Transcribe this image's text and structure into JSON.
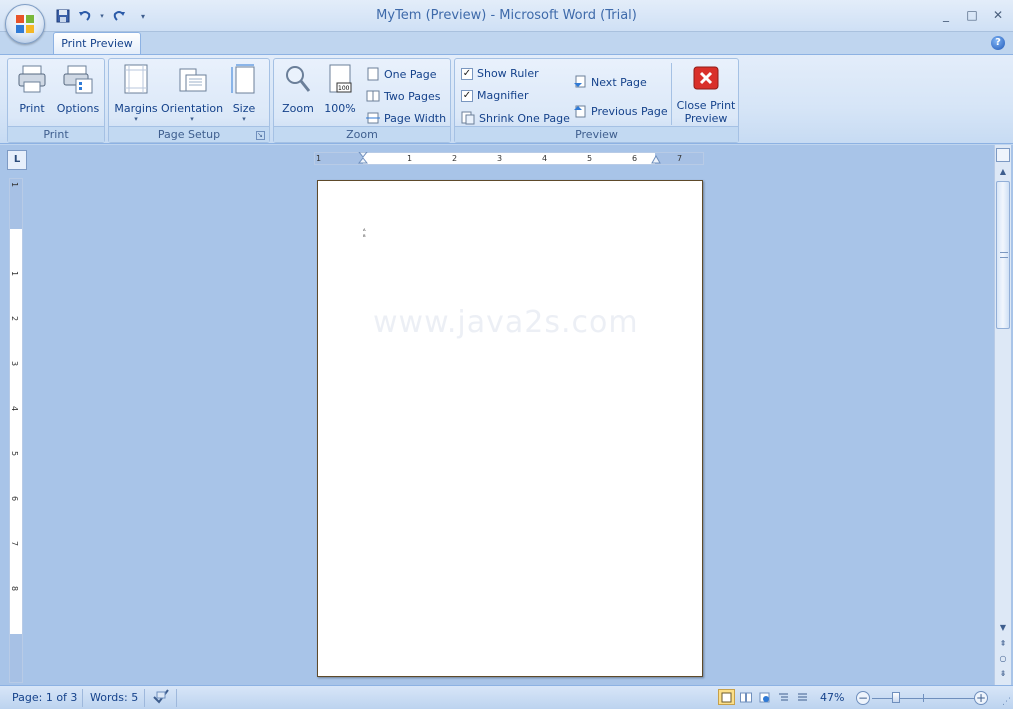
{
  "window": {
    "title": "MyTem (Preview) - Microsoft Word (Trial)",
    "controls": {
      "minimize": "_",
      "maximize": "□",
      "close": "✕"
    }
  },
  "tabs": [
    {
      "label": "Print Preview",
      "active": true
    }
  ],
  "help_label": "?",
  "ribbon": {
    "groups": [
      {
        "name": "print",
        "label": "Print",
        "buttons": [
          {
            "label": "Print"
          },
          {
            "label": "Options"
          }
        ]
      },
      {
        "name": "page_setup",
        "label": "Page Setup",
        "buttons": [
          {
            "label": "Margins"
          },
          {
            "label": "Orientation"
          },
          {
            "label": "Size"
          }
        ]
      },
      {
        "name": "zoom",
        "label": "Zoom",
        "buttons": [
          {
            "label": "Zoom"
          },
          {
            "label": "100%"
          },
          {
            "label": "One Page"
          },
          {
            "label": "Two Pages"
          },
          {
            "label": "Page Width"
          }
        ]
      },
      {
        "name": "preview",
        "label": "Preview",
        "checks": [
          {
            "label": "Show Ruler",
            "checked": true
          },
          {
            "label": "Magnifier",
            "checked": true
          }
        ],
        "buttons": [
          {
            "label": "Shrink One Page"
          },
          {
            "label": "Next Page"
          },
          {
            "label": "Previous Page"
          },
          {
            "label": "Close Print"
          },
          {
            "label": "Preview"
          }
        ]
      }
    ]
  },
  "ruler": {
    "tab_selector": "L",
    "h_ticks": [
      "1",
      "1",
      "2",
      "3",
      "4",
      "5",
      "6",
      "7"
    ],
    "v_ticks": [
      "1",
      "1",
      "2",
      "3",
      "4",
      "5",
      "6",
      "7",
      "8"
    ]
  },
  "document": {
    "watermark": "www.java2s.com",
    "mark_line1": "ᴬ",
    "mark_line2": "ᴮ"
  },
  "status": {
    "page": "Page: 1 of 3",
    "words": "Words: 5",
    "zoom": "47%",
    "zoom_level_percent": 47
  },
  "colors": {
    "accent": "#15428b",
    "ribbon_bg": "#dbe8f8",
    "workspace_bg": "#a8c4e8",
    "close_preview_red": "#d9302a"
  }
}
